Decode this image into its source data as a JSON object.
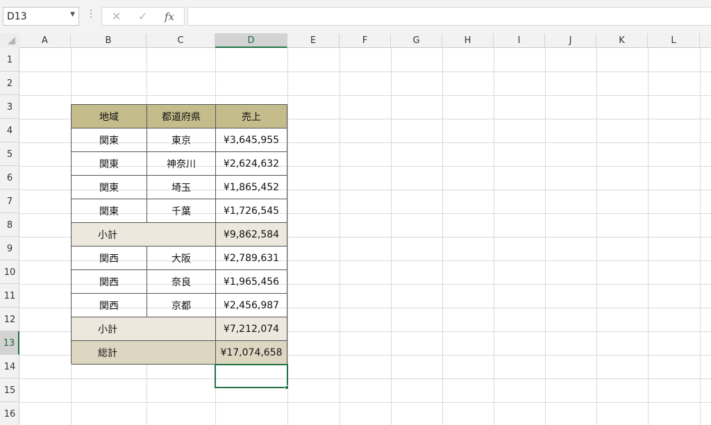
{
  "name_box": {
    "value": "D13"
  },
  "formula_bar": {
    "cancel_icon": "✕",
    "enter_icon": "✓",
    "fx_label": "fx",
    "value": ""
  },
  "columns": [
    "A",
    "B",
    "C",
    "D",
    "E",
    "F",
    "G",
    "H",
    "I",
    "J",
    "K",
    "L"
  ],
  "rows": [
    "1",
    "2",
    "3",
    "4",
    "5",
    "6",
    "7",
    "8",
    "9",
    "10",
    "11",
    "12",
    "13",
    "14",
    "15",
    "16"
  ],
  "selected_cell": {
    "column": "D",
    "row": "13"
  },
  "table": {
    "headers": [
      "地域",
      "都道府県",
      "売上"
    ],
    "rows": [
      {
        "kind": "data",
        "region": "関東",
        "prefecture": "東京",
        "sales": "¥3,645,955"
      },
      {
        "kind": "data",
        "region": "関東",
        "prefecture": "神奈川",
        "sales": "¥2,624,632"
      },
      {
        "kind": "data",
        "region": "関東",
        "prefecture": "埼玉",
        "sales": "¥1,865,452"
      },
      {
        "kind": "data",
        "region": "関東",
        "prefecture": "千葉",
        "sales": "¥1,726,545"
      },
      {
        "kind": "subtotal",
        "label": "小計",
        "sales": "¥9,862,584"
      },
      {
        "kind": "data",
        "region": "関西",
        "prefecture": "大阪",
        "sales": "¥2,789,631"
      },
      {
        "kind": "data",
        "region": "関西",
        "prefecture": "奈良",
        "sales": "¥1,965,456"
      },
      {
        "kind": "data",
        "region": "関西",
        "prefecture": "京都",
        "sales": "¥2,456,987"
      },
      {
        "kind": "subtotal",
        "label": "小計",
        "sales": "¥7,212,074"
      },
      {
        "kind": "total",
        "label": "総計",
        "sales": "¥17,074,658"
      }
    ]
  },
  "colors": {
    "header_fill": "#c4bd8b",
    "subtotal_fill": "#ece8dd",
    "total_fill": "#ddd6c1",
    "selection": "#217346"
  }
}
